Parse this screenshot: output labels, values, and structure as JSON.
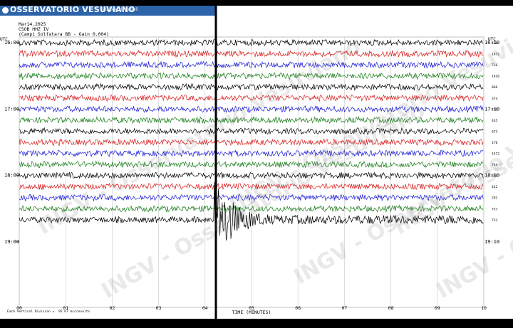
{
  "header": {
    "banner_title": "OSSERVATORIO VESUVIANO",
    "banner_subtitle": "Sezione di Napoli",
    "date": "Mar14,2025",
    "station": "CSOB HHZ IV",
    "location_gain": "(Campi Solfatara BB  - Gain 0.004)",
    "utc_left": "UTC",
    "utc_right": "UTC"
  },
  "left_time_labels": [
    "16:00",
    "17:00",
    "18:00",
    "19:00"
  ],
  "right_time_labels": [
    "16:10",
    "17:10",
    "18:10",
    "19:10"
  ],
  "trace_scales": [
    "436",
    "1472",
    "726",
    "1426",
    "866",
    "374",
    "479",
    "435",
    "673",
    "170",
    "1472",
    "744",
    "610",
    "432",
    "291",
    "757",
    "733"
  ],
  "x_axis": {
    "ticks": [
      "00",
      "01",
      "02",
      "03",
      "04",
      "05",
      "06",
      "07",
      "08",
      "09",
      "10"
    ],
    "label": "TIME (MINUTES)"
  },
  "footer": {
    "division": "Each Vertical Division =",
    "division_value": "95.67 microvolts"
  },
  "watermark": "INGV - Osservatorio Vesuviano",
  "colors": {
    "banner": "#2d63a8",
    "trace_cycle": [
      "#000000",
      "#d81b1b",
      "#1a1ad6",
      "#137a13"
    ],
    "grid": "#c8c8c8",
    "event_line": "#000000"
  },
  "chart_data": {
    "type": "line",
    "title": "",
    "xlabel": "TIME (MINUTES)",
    "ylabel": "",
    "xlim": [
      0,
      10
    ],
    "x_ticks": [
      "00",
      "01",
      "02",
      "03",
      "04",
      "05",
      "06",
      "07",
      "08",
      "09",
      "10"
    ],
    "rows_per_hour": 6,
    "series_count": 17,
    "event": {
      "onset_minute": 4.2,
      "description": "high-amplitude seismic event on last trace"
    }
  }
}
